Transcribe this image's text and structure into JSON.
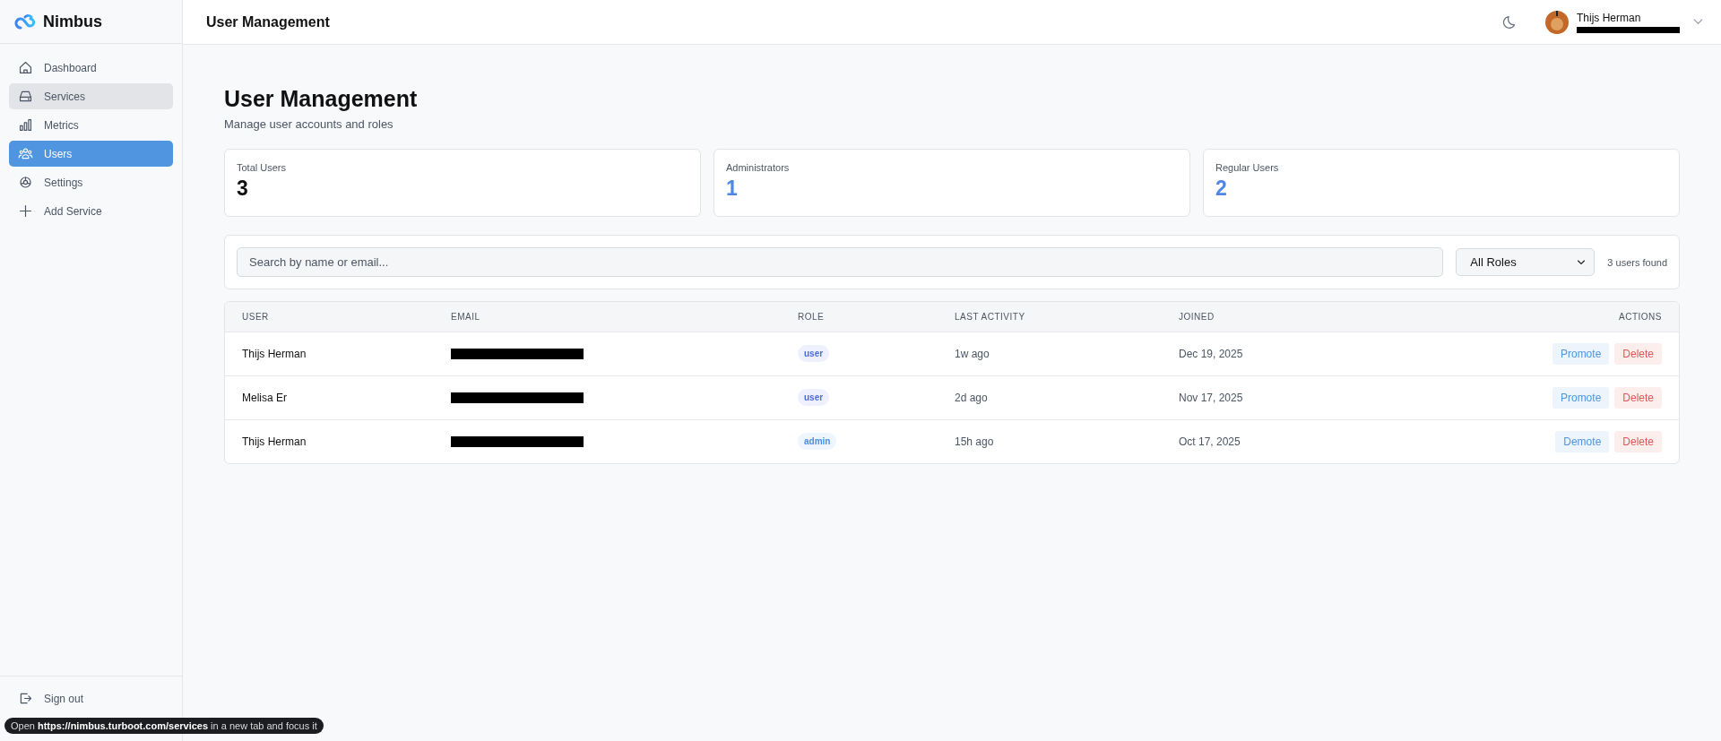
{
  "brand": {
    "name": "Nimbus"
  },
  "sidebar": {
    "items": [
      {
        "label": "Dashboard",
        "selected": false,
        "hovered": false
      },
      {
        "label": "Services",
        "selected": false,
        "hovered": true
      },
      {
        "label": "Metrics",
        "selected": false,
        "hovered": false
      },
      {
        "label": "Users",
        "selected": true,
        "hovered": false
      },
      {
        "label": "Settings",
        "selected": false,
        "hovered": false
      },
      {
        "label": "Add Service",
        "selected": false,
        "hovered": false
      }
    ],
    "sign_out": "Sign out"
  },
  "header": {
    "title": "User Management",
    "user": {
      "name": "Thijs Herman",
      "email_redacted": true
    }
  },
  "page": {
    "title": "User Management",
    "subtitle": "Manage user accounts and roles"
  },
  "stats": [
    {
      "label": "Total Users",
      "value": "3",
      "accent": false
    },
    {
      "label": "Administrators",
      "value": "1",
      "accent": true
    },
    {
      "label": "Regular Users",
      "value": "2",
      "accent": true
    }
  ],
  "filters": {
    "search": {
      "placeholder": "Search by name or email..."
    },
    "role_select": "All Roles",
    "count": "3 users found"
  },
  "table": {
    "columns": [
      "USER",
      "EMAIL",
      "ROLE",
      "LAST ACTIVITY",
      "JOINED",
      "ACTIONS"
    ],
    "rows": [
      {
        "user": "Thijs Herman",
        "email_redacted": true,
        "role": "user",
        "kind": "user",
        "last_activity": "1w ago",
        "joined": "Dec 19, 2025",
        "actions": [
          {
            "label": "Promote",
            "kind": "primary"
          },
          {
            "label": "Delete",
            "kind": "danger"
          }
        ]
      },
      {
        "user": "Melisa Er",
        "email_redacted": true,
        "role": "user",
        "kind": "user",
        "last_activity": "2d ago",
        "joined": "Nov 17, 2025",
        "actions": [
          {
            "label": "Promote",
            "kind": "primary"
          },
          {
            "label": "Delete",
            "kind": "danger"
          }
        ]
      },
      {
        "user": "Thijs Herman",
        "email_redacted": true,
        "role": "admin",
        "kind": "admin",
        "last_activity": "15h ago",
        "joined": "Oct 17, 2025",
        "actions": [
          {
            "label": "Demote",
            "kind": "primary"
          },
          {
            "label": "Delete",
            "kind": "danger"
          }
        ]
      }
    ]
  },
  "link_tooltip": "Open **https://nimbus.turboot.com/services** in a new tab and focus it"
}
